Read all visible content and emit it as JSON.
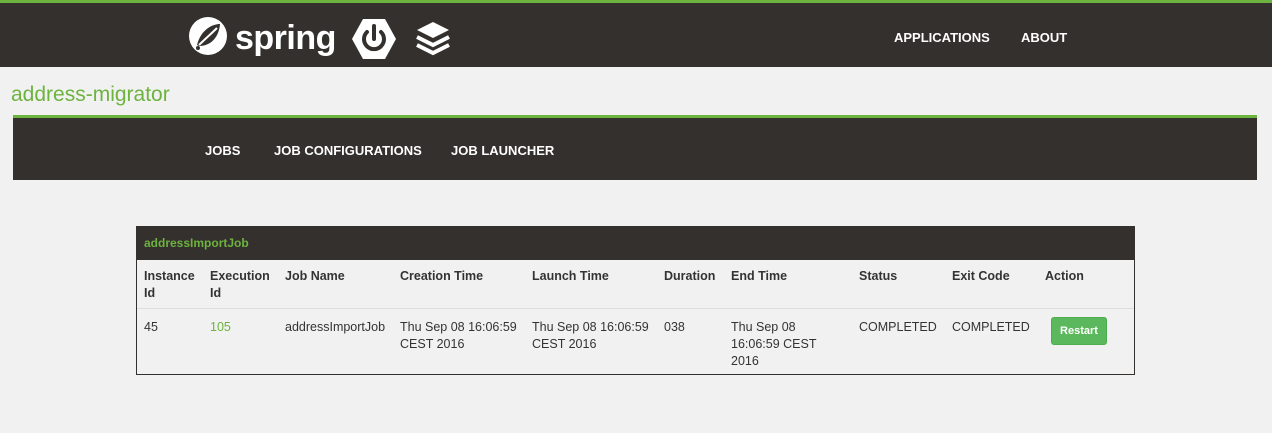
{
  "header": {
    "logo_text": "spring",
    "nav": [
      {
        "label": "APPLICATIONS"
      },
      {
        "label": "ABOUT"
      }
    ],
    "icons": [
      "spring-leaf-icon",
      "spring-boot-power-icon",
      "stack-layers-icon"
    ],
    "accent_color": "#6db33f",
    "bar_color": "#34302d"
  },
  "app": {
    "title": "address-migrator"
  },
  "subnav": [
    {
      "label": "JOBS"
    },
    {
      "label": "JOB CONFIGURATIONS"
    },
    {
      "label": "JOB LAUNCHER"
    }
  ],
  "job_panel": {
    "title": "addressImportJob",
    "columns": [
      "Instance Id",
      "Execution Id",
      "Job Name",
      "Creation Time",
      "Launch Time",
      "Duration",
      "End Time",
      "Status",
      "Exit Code",
      "Action"
    ],
    "rows": [
      {
        "instance_id": "45",
        "execution_id": "105",
        "job_name": "addressImportJob",
        "creation_time": "Thu Sep 08 16:06:59 CEST 2016",
        "launch_time": "Thu Sep 08 16:06:59 CEST 2016",
        "duration": "038",
        "end_time": "Thu Sep 08 16:06:59 CEST 2016",
        "status": "COMPLETED",
        "exit_code": "COMPLETED",
        "action_label": "Restart"
      }
    ]
  }
}
